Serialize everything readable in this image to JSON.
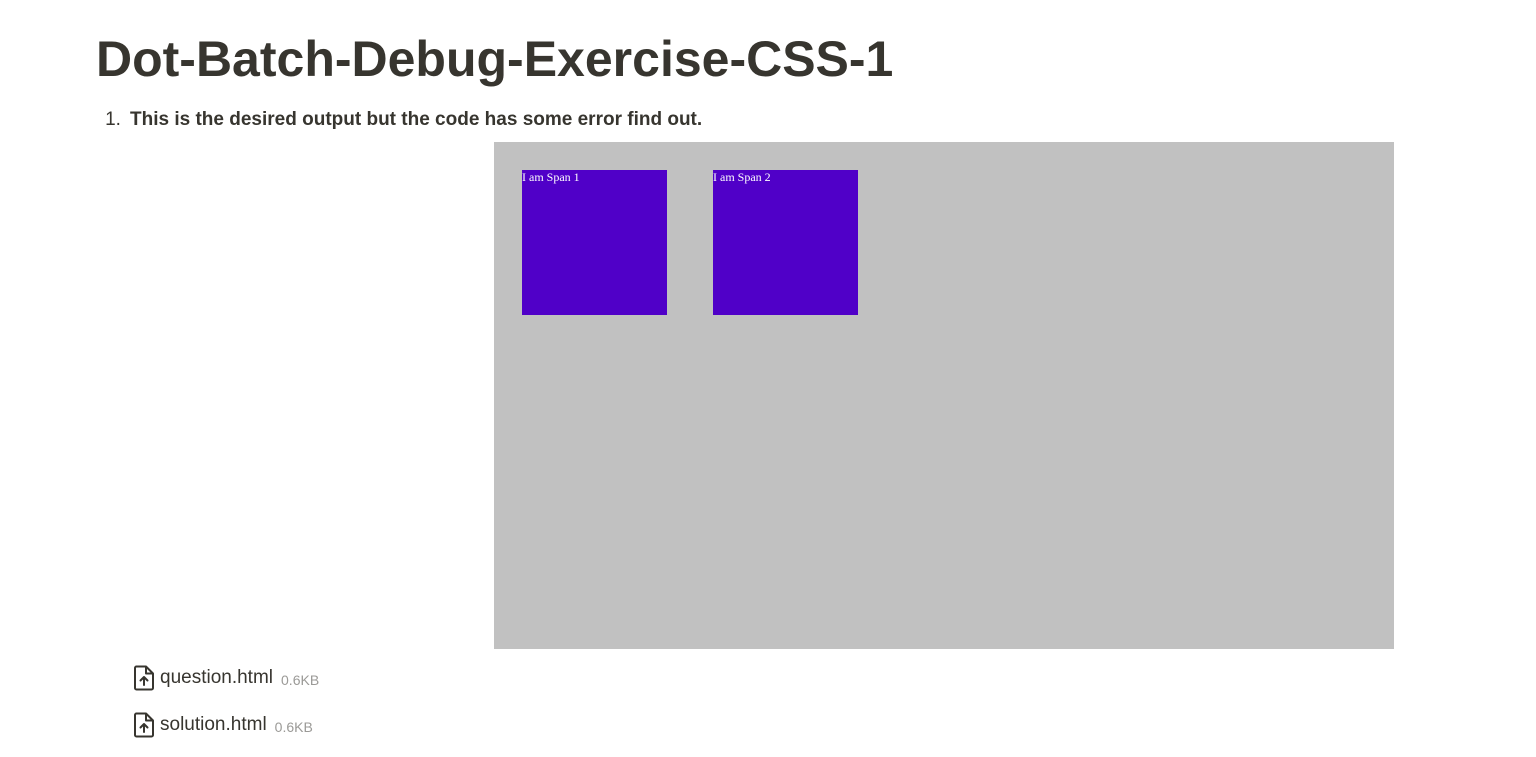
{
  "page": {
    "title": "Dot-Batch-Debug-Exercise-CSS-1"
  },
  "list": {
    "items": [
      {
        "number": "1.",
        "text": "This is the desired output but the code has some error find out."
      }
    ]
  },
  "preview": {
    "background": "#c1c1c1",
    "box_color": "#5000c8",
    "spans": [
      {
        "label": "I am Span 1"
      },
      {
        "label": "I am Span 2"
      }
    ]
  },
  "files": [
    {
      "name": "question.html",
      "size": "0.6KB",
      "icon": "file-upload-icon"
    },
    {
      "name": "solution.html",
      "size": "0.6KB",
      "icon": "file-upload-icon"
    }
  ]
}
